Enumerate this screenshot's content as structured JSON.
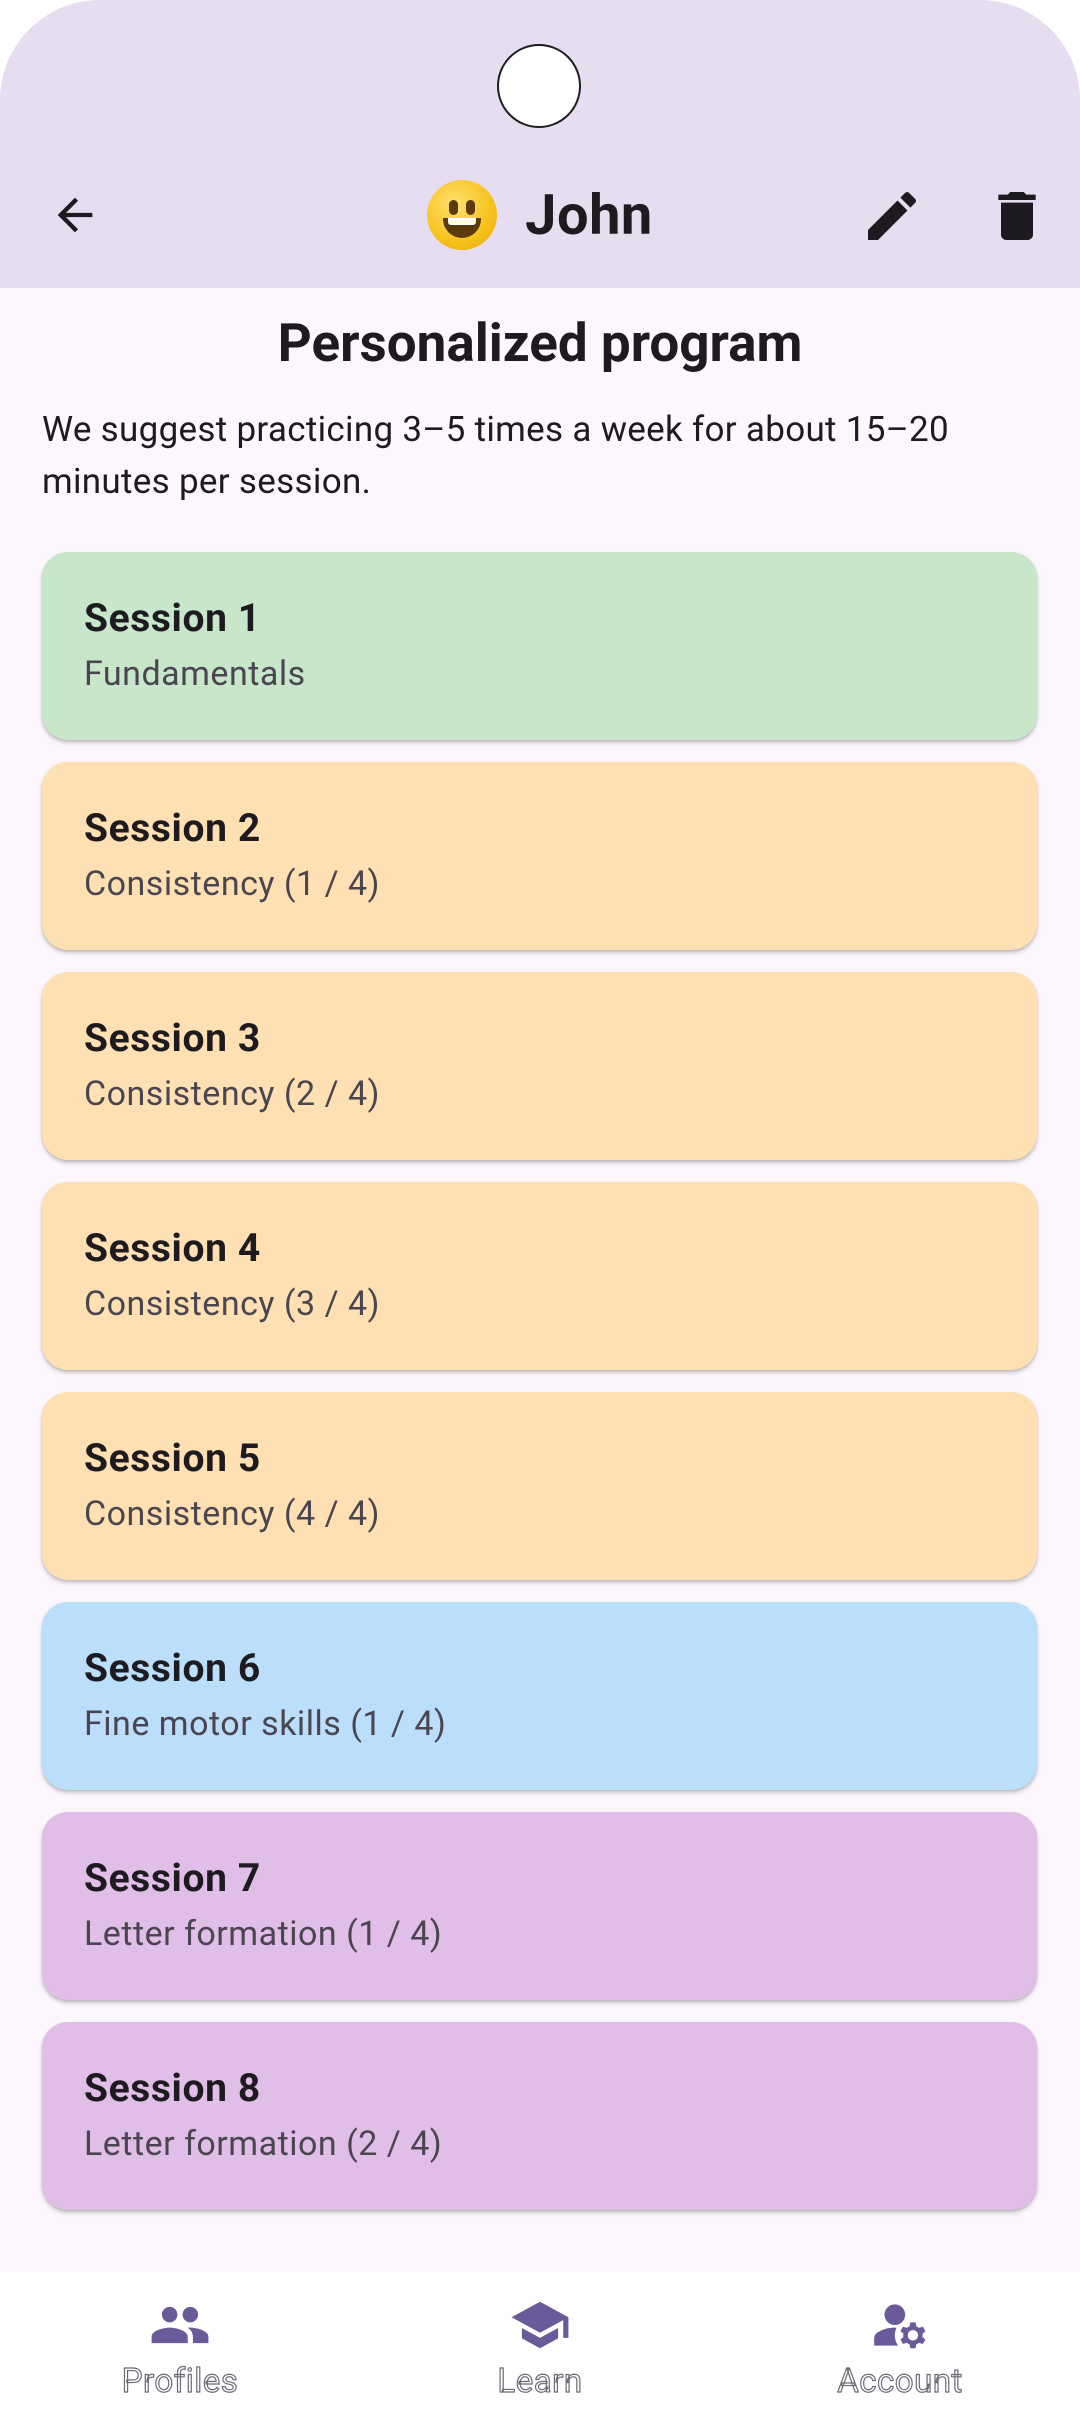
{
  "appbar": {
    "title": "John",
    "avatar_emoji_icon": "grinning-face-emoji",
    "back_icon": "arrow-back-icon",
    "edit_icon": "pencil-icon",
    "delete_icon": "trash-icon"
  },
  "main": {
    "heading": "Personalized program",
    "intro": "We suggest practicing 3–5 times a week for about 15–20 minutes per session.",
    "sessions": [
      {
        "title": "Session 1",
        "subtitle": "Fundamentals",
        "color": "#c8e6c9"
      },
      {
        "title": "Session 2",
        "subtitle": "Consistency (1 / 4)",
        "color": "#ffe0b2"
      },
      {
        "title": "Session 3",
        "subtitle": "Consistency (2 / 4)",
        "color": "#ffe0b2"
      },
      {
        "title": "Session 4",
        "subtitle": "Consistency (3 / 4)",
        "color": "#ffe0b2"
      },
      {
        "title": "Session 5",
        "subtitle": "Consistency (4 / 4)",
        "color": "#ffe0b2"
      },
      {
        "title": "Session 6",
        "subtitle": "Fine motor skills (1 / 4)",
        "color": "#bbdefb"
      },
      {
        "title": "Session 7",
        "subtitle": "Letter formation (1 / 4)",
        "color": "#e1bee7"
      },
      {
        "title": "Session 8",
        "subtitle": "Letter formation (2 / 4)",
        "color": "#e1bee7"
      }
    ]
  },
  "bottom_nav": {
    "items": [
      {
        "label": "Profiles",
        "icon": "people-icon"
      },
      {
        "label": "Learn",
        "icon": "graduation-cap-icon"
      },
      {
        "label": "Account",
        "icon": "manage-account-icon"
      }
    ],
    "icon_color": "#6b5a9a"
  }
}
